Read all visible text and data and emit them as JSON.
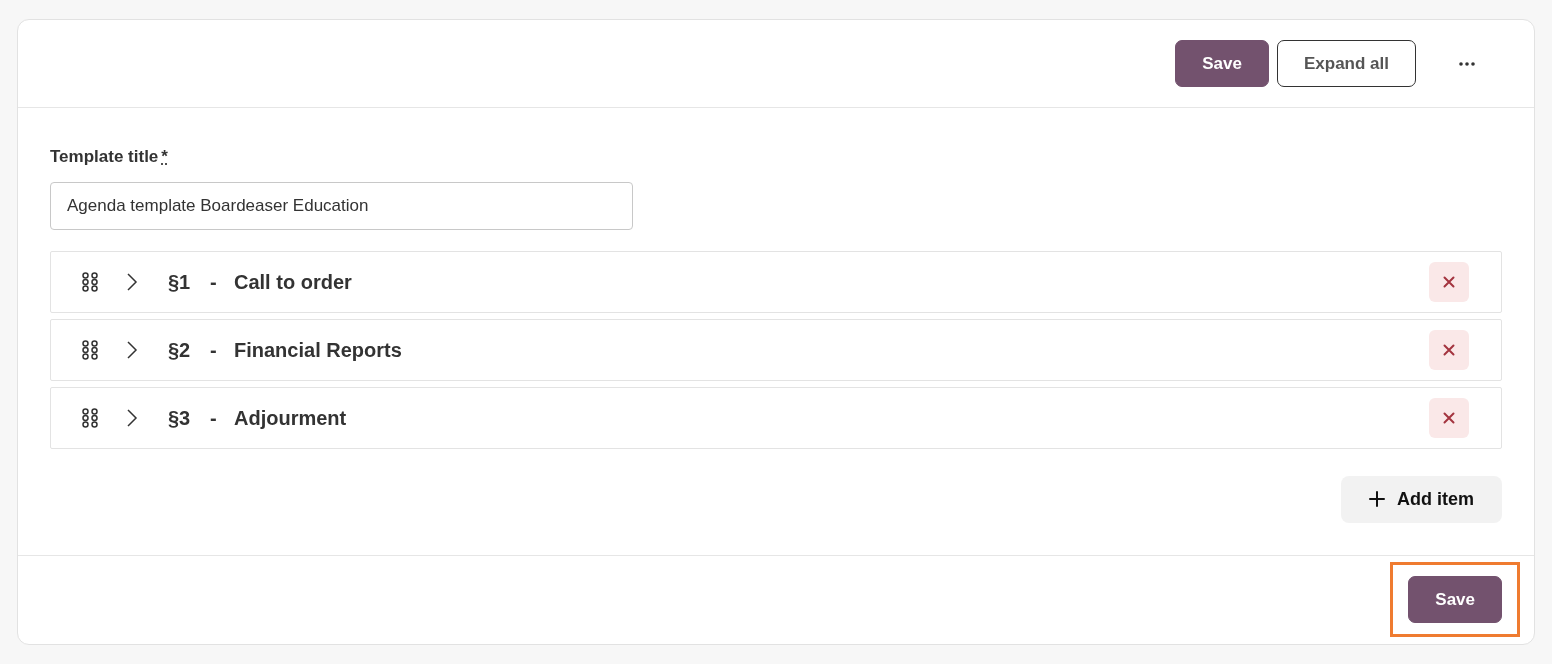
{
  "header": {
    "buttons": [
      {
        "label": "Save",
        "kind": "primary"
      },
      {
        "label": "Expand all",
        "kind": "outline"
      }
    ]
  },
  "form": {
    "label": "Template title",
    "required_mark": "*",
    "value": "Agenda template Boardeaser Education"
  },
  "items": [
    {
      "number": "§1",
      "separator": "-",
      "title": "Call to order",
      "expanded": false
    },
    {
      "number": "§2",
      "separator": "-",
      "title": "Financial Reports",
      "expanded": false
    },
    {
      "number": "§3",
      "separator": "-",
      "title": "Adjourment",
      "expanded": false
    }
  ],
  "add_button": {
    "label": "Add item"
  },
  "footer": {
    "save_button": {
      "label": "Save",
      "highlighted": true
    }
  }
}
